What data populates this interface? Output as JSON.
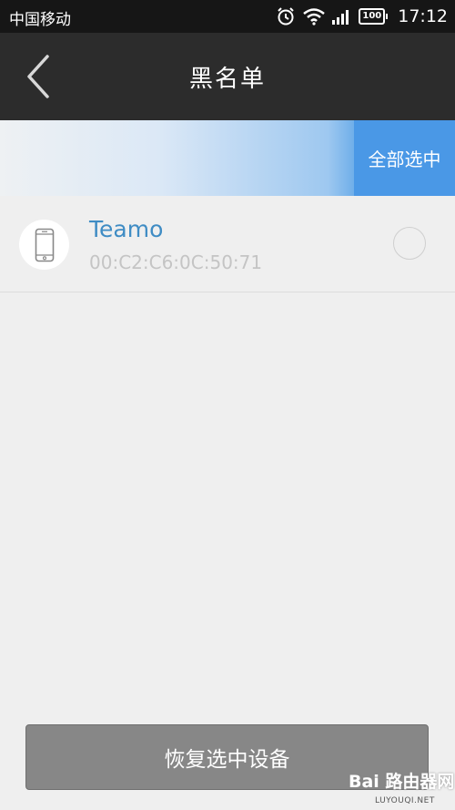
{
  "status_bar": {
    "carrier": "中国移动",
    "battery": "100",
    "time": "17:12"
  },
  "header": {
    "title": "黑名单"
  },
  "select_bar": {
    "select_all_label": "全部选中"
  },
  "devices": [
    {
      "name": "Teamo",
      "mac": "00:C2:C6:0C:50:71",
      "selected": false
    }
  ],
  "footer": {
    "restore_label": "恢复选中设备"
  },
  "watermark": {
    "text": "Bai 路由器网",
    "sub": "LUYOUQI.NET"
  },
  "colors": {
    "accent": "#4a98e6",
    "device_name": "#3f8cc4",
    "title_bar": "#2c2c2c"
  },
  "icons": {
    "back": "chevron-left-icon",
    "device": "phone-icon",
    "alarm": "alarm-clock-icon",
    "wifi": "wifi-icon",
    "signal": "signal-icon"
  }
}
